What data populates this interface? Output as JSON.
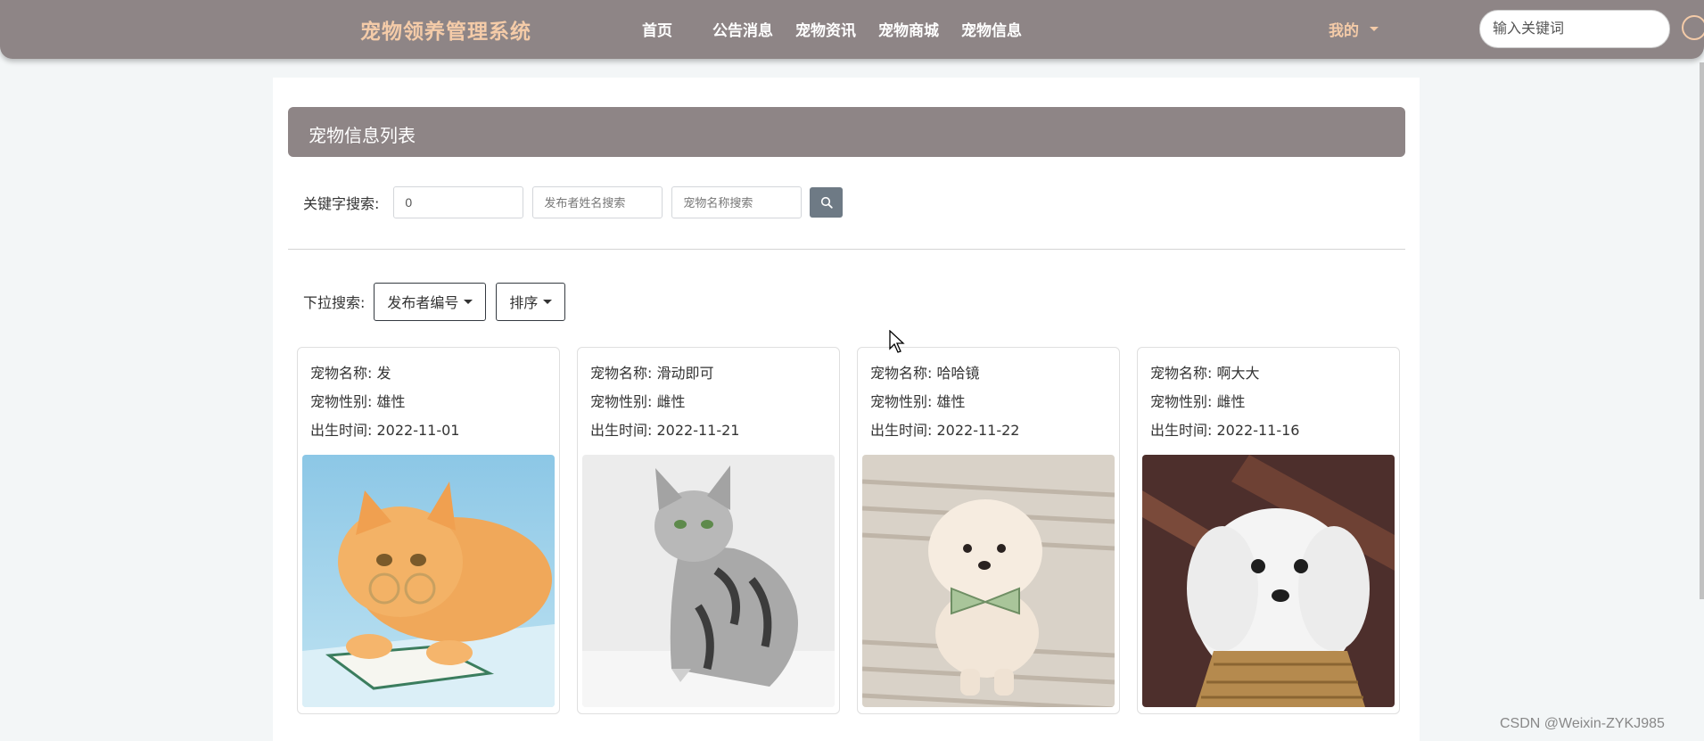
{
  "navbar": {
    "brand": "宠物领养管理系统",
    "links": [
      "首页",
      "公告消息",
      "宠物资讯",
      "宠物商城",
      "宠物信息"
    ],
    "me_label": "我的",
    "search_placeholder": "输入关键词",
    "colors": {
      "bar": "#8e8586",
      "accent": "#f4cba8"
    }
  },
  "list": {
    "title": "宠物信息列表",
    "keyword_label": "关键字搜索:",
    "keyword_value": "0",
    "publisher_placeholder": "发布者姓名搜索",
    "petname_placeholder": "宠物名称搜索",
    "dropdown_label": "下拉搜索:",
    "dropdown_publisher": "发布者编号",
    "dropdown_sort": "排序"
  },
  "cards": [
    {
      "name_label": "宠物名称: 发",
      "sex_label": "宠物性别: 雄性",
      "birth_label": "出生时间: 2022-11-01",
      "photo": "orange-cat-with-glasses"
    },
    {
      "name_label": "宠物名称: 滑动即可",
      "sex_label": "宠物性别: 雌性",
      "birth_label": "出生时间: 2022-11-21",
      "photo": "silver-tabby-cat"
    },
    {
      "name_label": "宠物名称: 哈哈镜",
      "sex_label": "宠物性别: 雄性",
      "birth_label": "出生时间: 2022-11-22",
      "photo": "pomeranian-with-bowtie"
    },
    {
      "name_label": "宠物名称: 啊大大",
      "sex_label": "宠物性别: 雌性",
      "birth_label": "出生时间: 2022-11-16",
      "photo": "white-maltese-puppy"
    }
  ],
  "watermark": "CSDN @Weixin-ZYKJ985"
}
